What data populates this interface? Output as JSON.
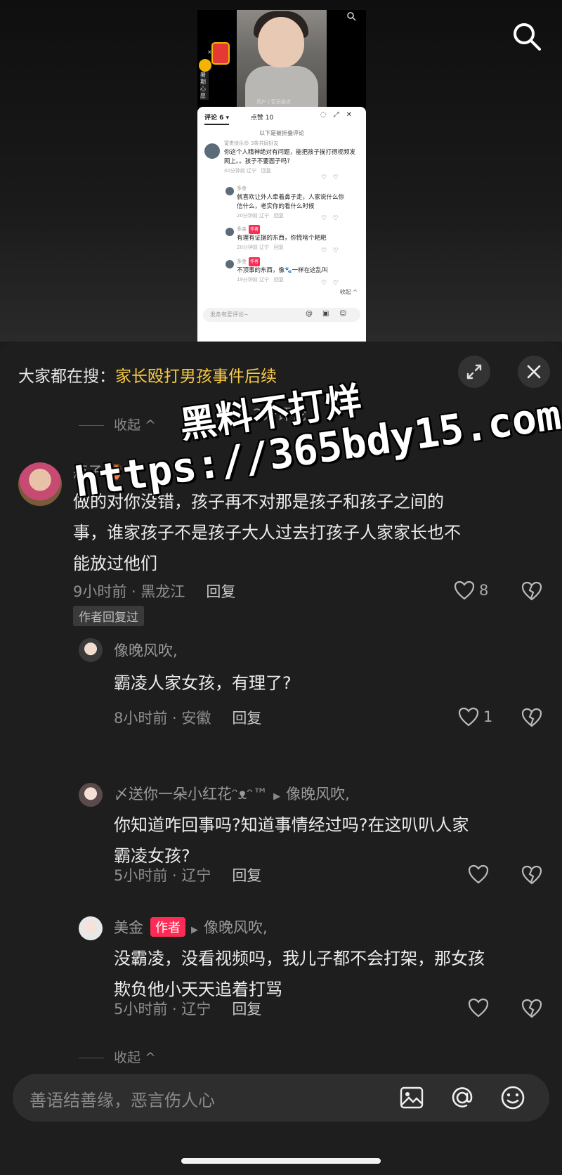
{
  "embed": {
    "video_caption": "用户 | 暂无描述",
    "redpack_label": "暑期心愿",
    "tabs": [
      "评论 6 ▾",
      "点赞 10"
    ],
    "folded_notice": "以下是被折叠评论",
    "comments": [
      {
        "name": "富贵快乐😊",
        "sub": "3条共同好友",
        "text": "你这个人精神绝对有问题，能把孩子挨打得视频发网上。。孩子不要面子吗?",
        "meta": "40分钟前 辽宁",
        "reply": "回复"
      },
      {
        "name": "多金",
        "author": false,
        "text": "就喜欢让外人牵着鼻子走，人家说什么你信什么，老实你的看什么时候",
        "meta": "20分钟前 辽宁",
        "reply": "回复"
      },
      {
        "name": "多金",
        "author": true,
        "text": "有理有证据的东西，你慌啥个耙耙",
        "meta": "20分钟前 辽宁",
        "reply": "回复"
      },
      {
        "name": "多金",
        "author": true,
        "text": "不顶事的东西，像🐾一样在这乱叫",
        "meta": "19分钟前 辽宁",
        "reply": "回复"
      }
    ],
    "author_tag": "作者",
    "collapse": "收起 ^",
    "input_placeholder": "发条有爱评论~"
  },
  "sheet": {
    "trend_prefix": "大家都在搜：",
    "trend_keyword": "家长殴打男孩事件后续",
    "count_label": "2条评论",
    "collapse_label": "收起 ^",
    "author_replied": "作者回复过",
    "comments": [
      {
        "user": "瓶子 🏺",
        "lines": [
          "做的对你没错，孩子再不对那是孩子和孩子之间的",
          "事，谁家孩子不是孩子大人过去打孩子人家家长也不",
          "能放过他们"
        ],
        "meta": "9小时前 · 黑龙江",
        "reply": "回复",
        "likes": "8"
      },
      {
        "user": "像晚风吹,",
        "lines": [
          "霸凌人家女孩，有理了?"
        ],
        "meta": "8小时前 · 安徽",
        "reply": "回复",
        "likes": "1"
      },
      {
        "user": "〆送你一朵小红花ᵔᴥᵔ™",
        "reply_to": "像晚风吹,",
        "lines": [
          "你知道咋回事吗?知道事情经过吗?在这叭叭人家",
          "霸凌女孩?"
        ],
        "meta": "5小时前 · 辽宁",
        "reply": "回复",
        "likes": ""
      },
      {
        "user": "美金",
        "author_tag": "作者",
        "reply_to": "像晚风吹,",
        "lines": [
          "没霸凌，没看视频吗，我儿子都不会打架，那女孩",
          "欺负他小天天追着打骂"
        ],
        "meta": "5小时前 · 辽宁",
        "reply": "回复",
        "likes": ""
      }
    ]
  },
  "input": {
    "placeholder": "善语结善缘，恶言伤人心"
  },
  "watermark": {
    "line1": "黑料不打烊",
    "line2": "https://365bdy15.com"
  },
  "icons": [
    "search-icon",
    "expand-icon",
    "close-icon",
    "heart-icon",
    "dislike-icon",
    "image-icon",
    "at-icon",
    "emoji-icon"
  ],
  "colors": {
    "accent": "#fe2c55",
    "trend": "#f6c945",
    "bg": "#1e1e1e"
  }
}
